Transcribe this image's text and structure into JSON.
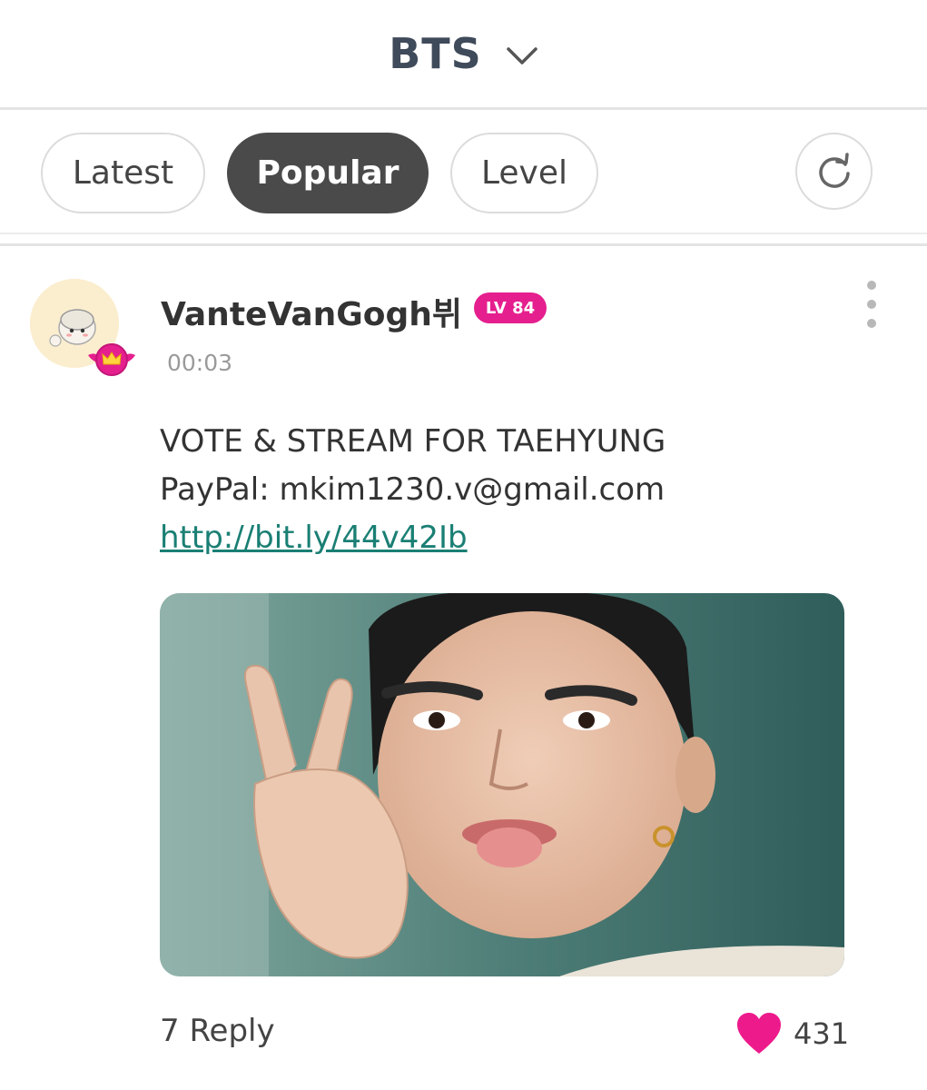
{
  "header": {
    "title": "BTS",
    "chevron_icon": "chevron-down-icon"
  },
  "tabs": [
    {
      "label": "Latest",
      "active": false
    },
    {
      "label": "Popular",
      "active": true
    },
    {
      "label": "Level",
      "active": false
    }
  ],
  "refresh_icon": "refresh-icon",
  "post": {
    "username": "VanteVanGogh뷔",
    "level_badge": "LV 84",
    "timestamp": "00:03",
    "text_lines": [
      "VOTE & STREAM FOR TAEHYUNG",
      "PayPal: mkim1230.v@gmail.com"
    ],
    "link": "http://bit.ly/44v42Ib",
    "reply_label": "7 Reply",
    "like_count": "431",
    "like_icon": "heart-icon",
    "more_icon": "more-vertical-icon"
  },
  "colors": {
    "accent_pink": "#e51f8e",
    "link_teal": "#1a7f74",
    "active_tab": "#4a4a4a"
  }
}
